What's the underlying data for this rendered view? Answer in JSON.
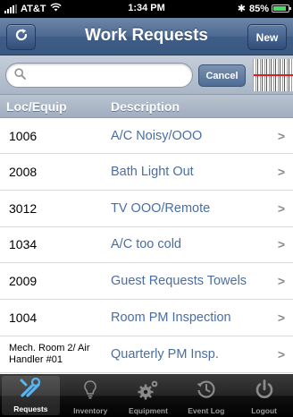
{
  "status_bar": {
    "carrier": "AT&T",
    "time": "1:34 PM",
    "battery_percent": "85%",
    "battery_level": 0.85
  },
  "nav_bar": {
    "title": "Work Requests",
    "refresh_icon": "refresh-icon",
    "new_label": "New"
  },
  "search": {
    "value": "",
    "placeholder": "",
    "cancel_label": "Cancel",
    "scan_icon": "barcode-scanner-icon"
  },
  "table": {
    "headers": {
      "location": "Loc/Equip",
      "description": "Description"
    },
    "rows": [
      {
        "location": "1006",
        "description": "A/C Noisy/OOO"
      },
      {
        "location": "2008",
        "description": "Bath Light Out"
      },
      {
        "location": "3012",
        "description": "TV OOO/Remote"
      },
      {
        "location": "1034",
        "description": "A/C too cold"
      },
      {
        "location": "2009",
        "description": "Guest Requests Towels"
      },
      {
        "location": "1004",
        "description": "Room PM Inspection"
      },
      {
        "location": "Mech. Room 2/ Air Handler #01",
        "description": "Quarterly PM Insp."
      }
    ]
  },
  "tab_bar": {
    "tabs": [
      {
        "label": "Requests",
        "icon": "tools-icon",
        "active": true
      },
      {
        "label": "Inventory",
        "icon": "lightbulb-icon",
        "active": false
      },
      {
        "label": "Equipment",
        "icon": "gears-icon",
        "active": false
      },
      {
        "label": "Event Log",
        "icon": "clock-history-icon",
        "active": false
      },
      {
        "label": "Logout",
        "icon": "power-icon",
        "active": false
      }
    ]
  },
  "colors": {
    "nav_bar": "#4d6a92",
    "link_text": "#4a6ea2",
    "active_tab_icon": "#5bb4ef"
  }
}
